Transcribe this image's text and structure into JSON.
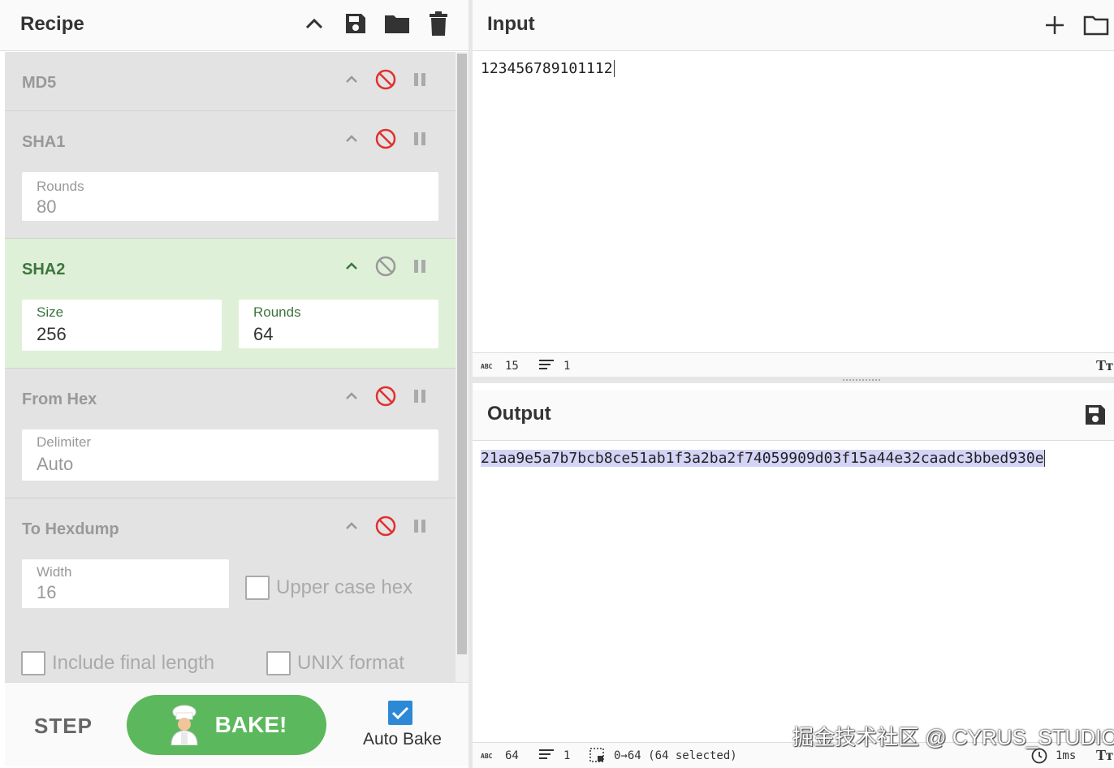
{
  "recipe": {
    "title": "Recipe",
    "operations": [
      {
        "name": "MD5"
      },
      {
        "name": "SHA1",
        "fields": [
          {
            "label": "Rounds",
            "value": "80"
          }
        ]
      },
      {
        "name": "SHA2",
        "fields": [
          {
            "label": "Size",
            "value": "256"
          },
          {
            "label": "Rounds",
            "value": "64"
          }
        ]
      },
      {
        "name": "From Hex",
        "fields": [
          {
            "label": "Delimiter",
            "value": "Auto"
          }
        ]
      },
      {
        "name": "To Hexdump",
        "fields": [
          {
            "label": "Width",
            "value": "16"
          }
        ],
        "checkboxes": [
          {
            "label": "Upper case hex",
            "checked": false
          },
          {
            "label": "Include final length",
            "checked": false
          },
          {
            "label": "UNIX format",
            "checked": false
          }
        ]
      }
    ]
  },
  "controls": {
    "step_label": "STEP",
    "bake_label": "BAKE!",
    "auto_bake_label": "Auto Bake",
    "auto_bake_checked": true
  },
  "input": {
    "title": "Input",
    "text": "123456789101112",
    "status": {
      "length": "15",
      "lines": "1"
    }
  },
  "output": {
    "title": "Output",
    "text": "21aa9e5a7b7bcb8ce51ab1f3a2ba2f74059909d03f15a44e32caadc3bbed930e",
    "status": {
      "length": "64",
      "lines": "1",
      "selection": "0→64 (64 selected)",
      "time": "1ms"
    }
  },
  "watermark": "掘金技术社区 @ CYRUS_STUDIO",
  "colors": {
    "active_op": "#dff0d8",
    "disable_icon": "#e0302f",
    "bake": "#5cb85c",
    "selection": "#d4d4f7"
  }
}
